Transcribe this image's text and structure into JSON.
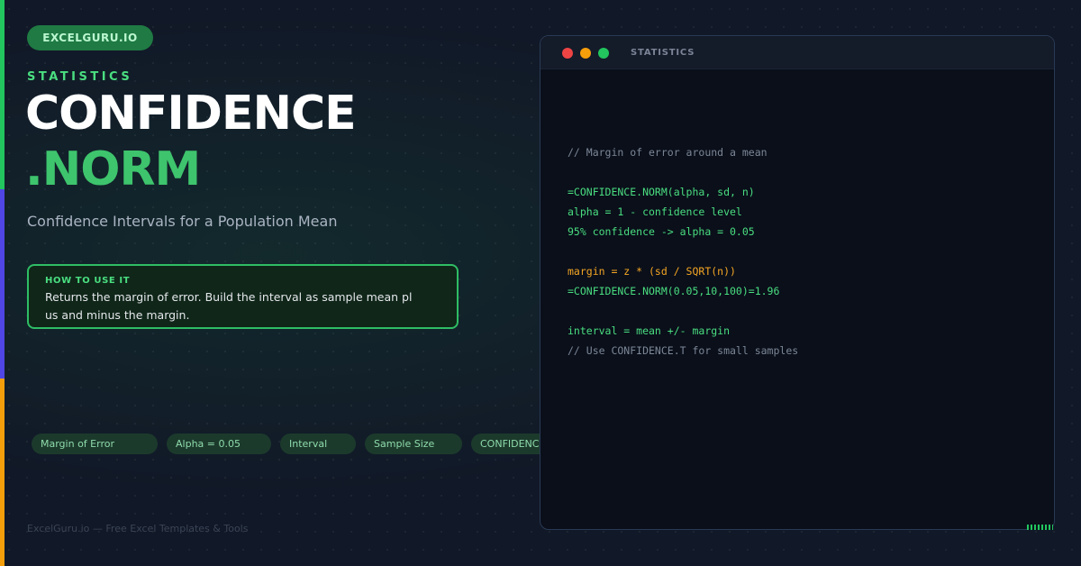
{
  "brand": "EXCELGURU.IO",
  "category": "STATISTICS",
  "title_line1": "CONFIDENCE",
  "title_line2": ".NORM",
  "subtitle": "Confidence Intervals for a Population Mean",
  "howto": {
    "label": "HOW TO USE IT",
    "text": "Returns the margin of error. Build the interval as sample mean plus and minus the margin."
  },
  "tags": [
    "Margin of Error",
    "Alpha = 0.05",
    "Interval",
    "Sample Size",
    "CONFIDENCE"
  ],
  "footer": "ExcelGuru.io — Free Excel Templates & Tools",
  "window": {
    "title": "STATISTICS",
    "code": [
      {
        "text": "// Margin of error around a mean",
        "kind": "comment"
      },
      {
        "text": "",
        "kind": "blank"
      },
      {
        "text": "=CONFIDENCE.NORM(alpha, sd, n)",
        "kind": "green"
      },
      {
        "text": "alpha = 1 - confidence level",
        "kind": "green"
      },
      {
        "text": "95% confidence -> alpha = 0.05",
        "kind": "green"
      },
      {
        "text": "",
        "kind": "blank"
      },
      {
        "text": "margin = z * (sd / SQRT(n))",
        "kind": "orange"
      },
      {
        "text": "=CONFIDENCE.NORM(0.05,10,100)=1.96",
        "kind": "green"
      },
      {
        "text": "",
        "kind": "blank"
      },
      {
        "text": "interval = mean +/- margin",
        "kind": "green"
      },
      {
        "text": "// Use CONFIDENCE.T for small samples",
        "kind": "comment"
      }
    ]
  },
  "colors": {
    "accent_green": "#22c55e",
    "accent_indigo": "#4f46e5",
    "accent_orange": "#f59e0b",
    "background": "#111827"
  }
}
